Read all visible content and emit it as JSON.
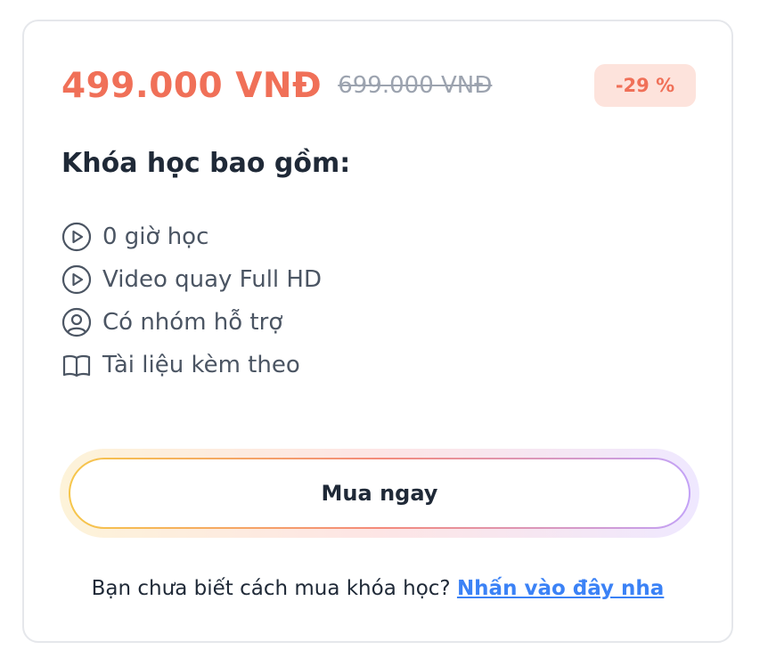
{
  "pricing": {
    "current_price": "499.000 VNĐ",
    "original_price": "699.000 VNĐ",
    "discount_badge": "-29 %"
  },
  "includes": {
    "title": "Khóa học bao gồm:",
    "items": [
      {
        "icon": "play-circle-icon",
        "label": "0 giờ học"
      },
      {
        "icon": "play-circle-icon",
        "label": "Video quay Full HD"
      },
      {
        "icon": "user-circle-icon",
        "label": "Có nhóm hỗ trợ"
      },
      {
        "icon": "book-open-icon",
        "label": "Tài liệu kèm theo"
      }
    ]
  },
  "buy_button": {
    "label": "Mua ngay"
  },
  "help": {
    "text": "Bạn chưa biết cách mua khóa học? ",
    "link_text": "Nhấn vào đây nha"
  },
  "colors": {
    "accent": "#f07058",
    "discount_bg": "#fde3dc",
    "link": "#3b82f6",
    "text": "#1f2937",
    "muted": "#4b5563"
  }
}
